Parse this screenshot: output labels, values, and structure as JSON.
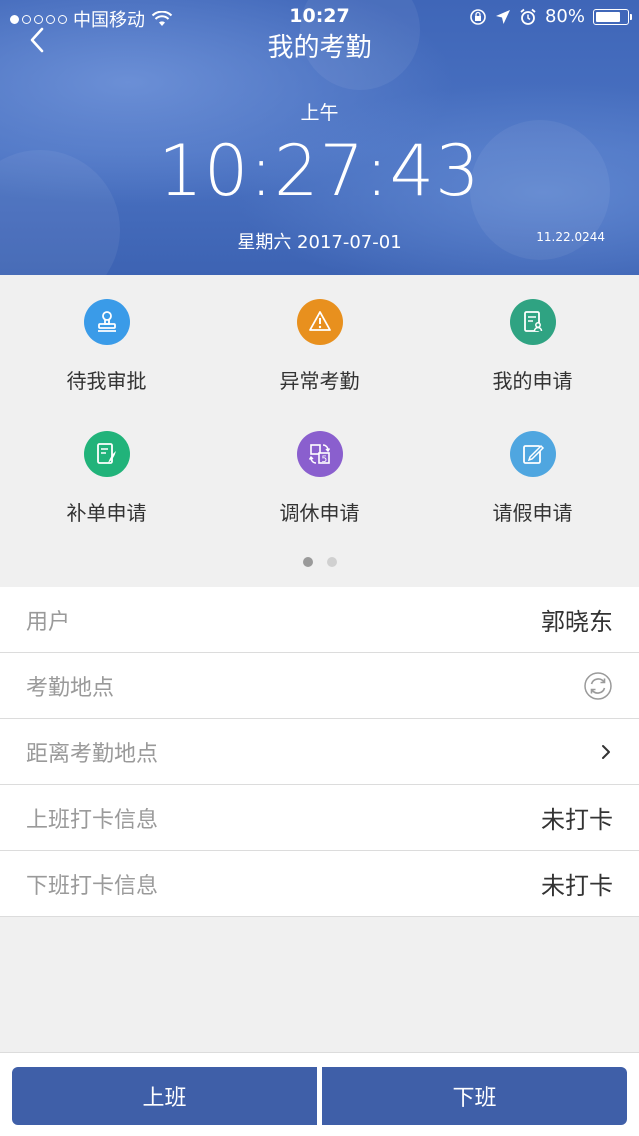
{
  "statusbar": {
    "carrier": "中国移动",
    "time": "10:27",
    "battery": "80%",
    "battery_level": 0.8
  },
  "header": {
    "title": "我的考勤",
    "ampm": "上午",
    "clock": "10:27:43",
    "date": "星期六 2017-07-01",
    "version": "11.22.0244"
  },
  "grid": {
    "items": [
      {
        "label": "待我审批",
        "icon": "stamp-icon",
        "color": "#3a9be8"
      },
      {
        "label": "异常考勤",
        "icon": "warning-icon",
        "color": "#e8901e"
      },
      {
        "label": "我的申请",
        "icon": "document-user-icon",
        "color": "#2fa382"
      },
      {
        "label": "补单申请",
        "icon": "form-pen-icon",
        "color": "#21b37a"
      },
      {
        "label": "调休申请",
        "icon": "calendar-swap-icon",
        "color": "#8a5fce"
      },
      {
        "label": "请假申请",
        "icon": "edit-note-icon",
        "color": "#4fa6e0"
      }
    ],
    "page_count": 2,
    "active_page": 1
  },
  "list": {
    "user_label": "用户",
    "user_value": "郭晓东",
    "location_label": "考勤地点",
    "distance_label": "距离考勤地点",
    "checkin_label": "上班打卡信息",
    "checkin_value": "未打卡",
    "checkout_label": "下班打卡信息",
    "checkout_value": "未打卡"
  },
  "buttons": {
    "clock_in": "上班",
    "clock_out": "下班",
    "color": "#3f5fa8"
  }
}
